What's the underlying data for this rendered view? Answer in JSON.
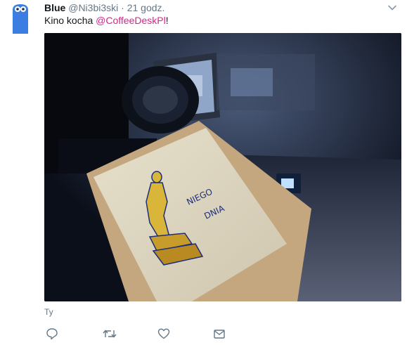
{
  "tweet": {
    "author_name": "Blue",
    "author_handle": "@Ni3bi3ski",
    "separator": "·",
    "time": "21 godz.",
    "text_before": "Kino kocha ",
    "mention": "@CoffeeDeskPl",
    "text_after": "!",
    "translate_label": "Ty"
  },
  "media": {
    "card_text_line1": "NIEGO",
    "card_text_line2": "DNIA"
  },
  "icons": {
    "avatar": "blue-monster-avatar",
    "caret": "chevron-down-icon",
    "reply": "reply-icon",
    "retweet": "retweet-icon",
    "like": "heart-icon",
    "message": "envelope-icon"
  },
  "colors": {
    "text": "#14171a",
    "secondary": "#657786",
    "link": "#d6248e",
    "avatar_blue": "#3b7de0"
  }
}
